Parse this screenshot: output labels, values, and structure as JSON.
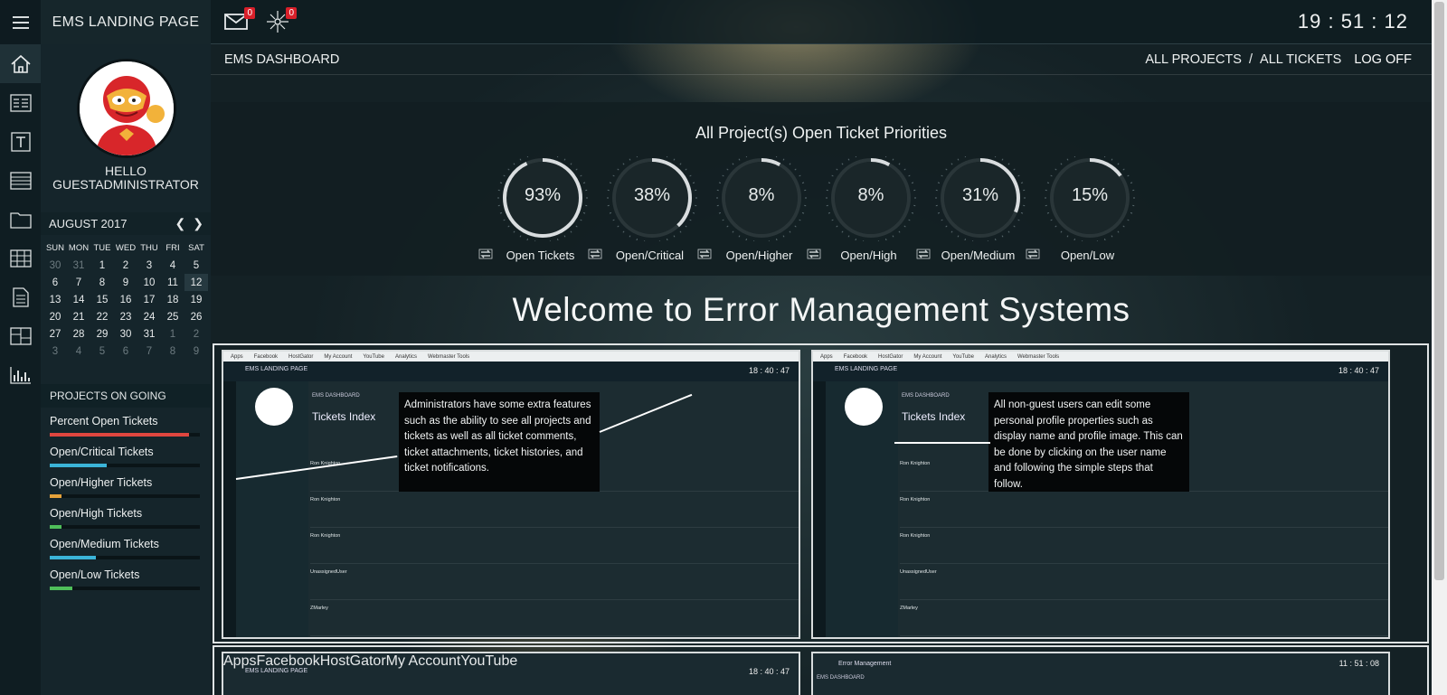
{
  "topbar": {
    "brand": "EMS LANDING PAGE",
    "mail_count": "0",
    "alerts_count": "0",
    "clock": "19 : 51 : 12"
  },
  "rail": {
    "items": [
      "home-icon",
      "list-icon",
      "text-icon",
      "table-rows-icon",
      "folder-icon",
      "grid-icon",
      "document-icon",
      "dashboard-icon",
      "bar-chart-icon"
    ]
  },
  "user": {
    "greeting": "HELLO",
    "name": "GUESTADMINISTRATOR"
  },
  "calendar": {
    "month": "AUGUST 2017",
    "days_of_week": [
      "SUN",
      "MON",
      "TUE",
      "WED",
      "THU",
      "FRI",
      "SAT"
    ],
    "weeks": [
      [
        "30",
        "31",
        "1",
        "2",
        "3",
        "4",
        "5"
      ],
      [
        "6",
        "7",
        "8",
        "9",
        "10",
        "11",
        "12"
      ],
      [
        "13",
        "14",
        "15",
        "16",
        "17",
        "18",
        "19"
      ],
      [
        "20",
        "21",
        "22",
        "23",
        "24",
        "25",
        "26"
      ],
      [
        "27",
        "28",
        "29",
        "30",
        "31",
        "1",
        "2"
      ],
      [
        "3",
        "4",
        "5",
        "6",
        "7",
        "8",
        "9"
      ]
    ],
    "today": "12"
  },
  "projects": {
    "header": "PROJECTS ON GOING",
    "items": [
      {
        "label": "Percent Open Tickets",
        "value": 0.93,
        "color": "#e0463f"
      },
      {
        "label": "Open/Critical Tickets",
        "value": 0.38,
        "color": "#3bb4d8"
      },
      {
        "label": "Open/Higher Tickets",
        "value": 0.08,
        "color": "#e6a23a"
      },
      {
        "label": "Open/High Tickets",
        "value": 0.08,
        "color": "#4fbf5a"
      },
      {
        "label": "Open/Medium Tickets",
        "value": 0.31,
        "color": "#3bb4d8"
      },
      {
        "label": "Open/Low Tickets",
        "value": 0.15,
        "color": "#4fbf5a"
      }
    ]
  },
  "main": {
    "title": "EMS DASHBOARD",
    "all_projects": "ALL PROJECTS",
    "separator": "/",
    "all_tickets": "ALL TICKETS",
    "log_off": "LOG OFF"
  },
  "priorities": {
    "title": "All Project(s) Open Ticket Priorities",
    "gauges": [
      {
        "value": "93%",
        "fraction": 0.93,
        "label": "Open Tickets"
      },
      {
        "value": "38%",
        "fraction": 0.38,
        "label": "Open/Critical"
      },
      {
        "value": "8%",
        "fraction": 0.08,
        "label": "Open/Higher"
      },
      {
        "value": "8%",
        "fraction": 0.08,
        "label": "Open/High"
      },
      {
        "value": "31%",
        "fraction": 0.31,
        "label": "Open/Medium"
      },
      {
        "value": "15%",
        "fraction": 0.15,
        "label": "Open/Low"
      }
    ]
  },
  "welcome": "Welcome to Error Management Systems",
  "screenshots": {
    "left": {
      "brand": "EMS LANDING PAGE",
      "clock": "18 : 40 : 47",
      "dashboard": "EMS DASHBOARD",
      "title": "Tickets Index",
      "callout": "Administrators have some extra features such as the ability to see all projects and tickets as well as all ticket comments, ticket attachments, ticket histories, and ticket notifications.",
      "rows": [
        "Ron Knighton",
        "Ron Knighton",
        "Ron Knighton",
        "UnassignedUser",
        "ZMarley"
      ]
    },
    "right": {
      "brand": "EMS LANDING PAGE",
      "clock": "18 : 40 : 47",
      "dashboard": "EMS DASHBOARD",
      "title": "Tickets Index",
      "callout": "All non-guest users can edit some personal profile properties such as display name and profile image. This can be done by clicking on the user name and following the  simple steps that follow.",
      "rows": [
        "Ron Knighton",
        "Ron Knighton",
        "Ron Knighton",
        "UnassignedUser",
        "ZMarley"
      ]
    },
    "bottom_left": {
      "brand": "EMS LANDING PAGE",
      "clock": "18 : 40 : 47"
    },
    "bottom_right": {
      "brand": "Error Management",
      "clock": "11 : 51 : 08",
      "dashboard": "EMS DASHBOARD"
    }
  }
}
